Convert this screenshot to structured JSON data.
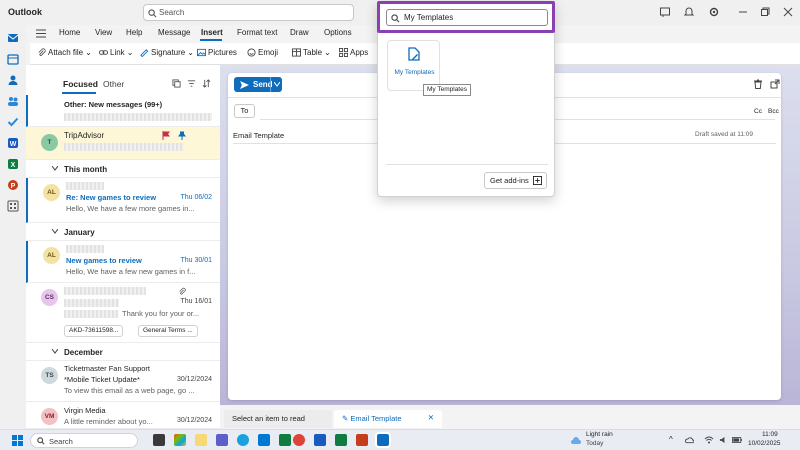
{
  "app": {
    "title": "Outlook"
  },
  "search": {
    "placeholder": "Search"
  },
  "ribbon_tabs": [
    "Home",
    "View",
    "Help",
    "Message",
    "Insert",
    "Format text",
    "Draw",
    "Options"
  ],
  "ribbon_tabs_active": "Insert",
  "ribbon": {
    "attach": "Attach file",
    "link": "Link",
    "signature": "Signature",
    "pictures": "Pictures",
    "emoji": "Emoji",
    "table": "Table",
    "apps": "Apps"
  },
  "mail_list": {
    "tab_focused": "Focused",
    "tab_other": "Other",
    "other_banner": "Other: New messages (99+)",
    "items_tripadvisor": {
      "sender": "TripAdvisor",
      "avatar": "T"
    },
    "section_this_month": "This month",
    "item_1": {
      "avatar": "AL",
      "subject": "Re: New games to review",
      "date": "Thu 06/02",
      "preview": "Hello, We have a few more games in..."
    },
    "section_january": "January",
    "item_2": {
      "avatar": "AL",
      "subject": "New games to review",
      "date": "Thu 30/01",
      "preview": "Hello, We have a few new games in f..."
    },
    "item_3": {
      "avatar": "CS",
      "date": "Thu 16/01",
      "preview": "Thank you for your or...",
      "attachment_1": "AKD-73611598...",
      "attachment_2": "General Terms ..."
    },
    "section_december": "December",
    "item_4": {
      "avatar": "TS",
      "sender": "Ticketmaster Fan Support",
      "subject": "*Mobile Ticket Update*",
      "date": "30/12/2024",
      "preview": "To view this email as a web page, go ..."
    },
    "item_5": {
      "avatar": "VM",
      "sender": "Virgin Media",
      "date": "30/12/2024",
      "preview": "A little reminder about yo..."
    }
  },
  "compose": {
    "send": "Send",
    "to": "To",
    "cc": "Cc",
    "bcc": "Bcc",
    "subject": "Email Template",
    "draft_status": "Draft saved at 11:09"
  },
  "bottom_tabs": {
    "read": "Select an item to read",
    "draft": "Email Template"
  },
  "popup": {
    "search_value": "My Templates",
    "tile_label": "My Templates",
    "tooltip": "My Templates",
    "get_addins": "Get add-ins"
  },
  "taskbar": {
    "search": "Search",
    "weather_title": "Light rain",
    "weather_sub": "Today",
    "time": "11:09",
    "date": "10/02/2025"
  },
  "colors": {
    "accent": "#0f6cbd",
    "highlight_box": "#8a3fb5",
    "selected_row": "#fdf6d7"
  }
}
